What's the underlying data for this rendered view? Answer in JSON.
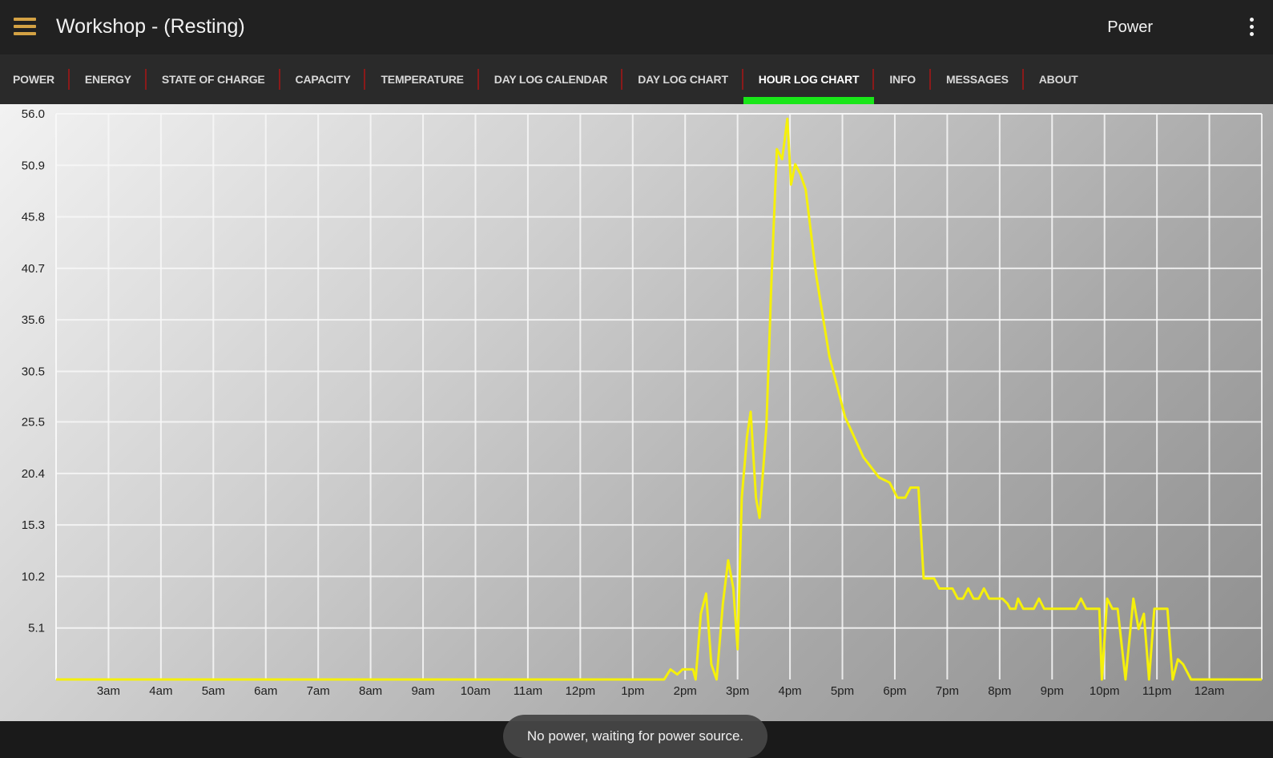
{
  "header": {
    "title": "Workshop - (Resting)",
    "mode_label": "Power"
  },
  "tabs": [
    {
      "label": "POWER",
      "active": false
    },
    {
      "label": "ENERGY",
      "active": false
    },
    {
      "label": "STATE OF CHARGE",
      "active": false
    },
    {
      "label": "CAPACITY",
      "active": false
    },
    {
      "label": "TEMPERATURE",
      "active": false
    },
    {
      "label": "DAY LOG CALENDAR",
      "active": false
    },
    {
      "label": "DAY LOG CHART",
      "active": false
    },
    {
      "label": "HOUR LOG CHART",
      "active": true
    },
    {
      "label": "INFO",
      "active": false
    },
    {
      "label": "MESSAGES",
      "active": false
    },
    {
      "label": "ABOUT",
      "active": false
    }
  ],
  "colors": {
    "accent_tab": "#19e619",
    "separator": "#8a1a1a",
    "menu_icon": "#d4a244",
    "line": "#f5f00a"
  },
  "toast": "No power, waiting for power source.",
  "chart_data": {
    "type": "line",
    "title": "",
    "xlabel": "",
    "ylabel": "",
    "y_ticks": [
      "56.0",
      "50.9",
      "45.8",
      "40.7",
      "35.6",
      "30.5",
      "25.5",
      "20.4",
      "15.3",
      "10.2",
      "5.1"
    ],
    "x_ticks": [
      "3am",
      "4am",
      "5am",
      "6am",
      "7am",
      "8am",
      "9am",
      "10am",
      "11am",
      "12pm",
      "1pm",
      "2pm",
      "3pm",
      "4pm",
      "5pm",
      "6pm",
      "7pm",
      "8pm",
      "9pm",
      "10pm",
      "11pm",
      "12am"
    ],
    "ylim": [
      0,
      56.0
    ],
    "xlim": [
      2,
      25
    ],
    "grid": true,
    "series": [
      {
        "points": [
          [
            2.0,
            0
          ],
          [
            13.6,
            0
          ],
          [
            13.72,
            1.0
          ],
          [
            13.85,
            0.5
          ],
          [
            13.95,
            1.0
          ],
          [
            14.15,
            1.0
          ],
          [
            14.2,
            0
          ],
          [
            14.3,
            6.5
          ],
          [
            14.4,
            8.5
          ],
          [
            14.5,
            1.5
          ],
          [
            14.6,
            0
          ],
          [
            14.72,
            7.5
          ],
          [
            14.82,
            11.8
          ],
          [
            14.92,
            9.0
          ],
          [
            15.0,
            3.0
          ],
          [
            15.08,
            18.0
          ],
          [
            15.18,
            24.0
          ],
          [
            15.25,
            26.5
          ],
          [
            15.35,
            18.0
          ],
          [
            15.42,
            16.0
          ],
          [
            15.55,
            25.0
          ],
          [
            15.65,
            40.0
          ],
          [
            15.75,
            52.5
          ],
          [
            15.85,
            51.5
          ],
          [
            15.95,
            55.5
          ],
          [
            16.02,
            49.0
          ],
          [
            16.1,
            51.0
          ],
          [
            16.2,
            50.0
          ],
          [
            16.3,
            48.5
          ],
          [
            16.5,
            40.0
          ],
          [
            16.75,
            32.0
          ],
          [
            17.05,
            26.0
          ],
          [
            17.4,
            22.0
          ],
          [
            17.7,
            20.0
          ],
          [
            17.9,
            19.5
          ],
          [
            18.05,
            18.0
          ],
          [
            18.2,
            18.0
          ],
          [
            18.3,
            19.0
          ],
          [
            18.45,
            19.0
          ],
          [
            18.55,
            10.0
          ],
          [
            18.75,
            10.0
          ],
          [
            18.85,
            9.0
          ],
          [
            19.1,
            9.0
          ],
          [
            19.2,
            8.0
          ],
          [
            19.3,
            8.0
          ],
          [
            19.4,
            9.0
          ],
          [
            19.5,
            8.0
          ],
          [
            19.6,
            8.0
          ],
          [
            19.7,
            9.0
          ],
          [
            19.8,
            8.0
          ],
          [
            20.05,
            8.0
          ],
          [
            20.15,
            7.5
          ],
          [
            20.2,
            7.0
          ],
          [
            20.3,
            7.0
          ],
          [
            20.35,
            8.0
          ],
          [
            20.45,
            7.0
          ],
          [
            20.65,
            7.0
          ],
          [
            20.75,
            8.0
          ],
          [
            20.85,
            7.0
          ],
          [
            21.45,
            7.0
          ],
          [
            21.55,
            8.0
          ],
          [
            21.65,
            7.0
          ],
          [
            21.9,
            7.0
          ],
          [
            21.95,
            0
          ],
          [
            22.05,
            8.0
          ],
          [
            22.15,
            7.0
          ],
          [
            22.25,
            7.0
          ],
          [
            22.4,
            0
          ],
          [
            22.55,
            8.0
          ],
          [
            22.65,
            5.0
          ],
          [
            22.75,
            6.5
          ],
          [
            22.85,
            0
          ],
          [
            22.95,
            7.0
          ],
          [
            23.2,
            7.0
          ],
          [
            23.3,
            0
          ],
          [
            23.4,
            2.0
          ],
          [
            23.5,
            1.5
          ],
          [
            23.65,
            0
          ],
          [
            25.0,
            0
          ]
        ]
      }
    ]
  }
}
